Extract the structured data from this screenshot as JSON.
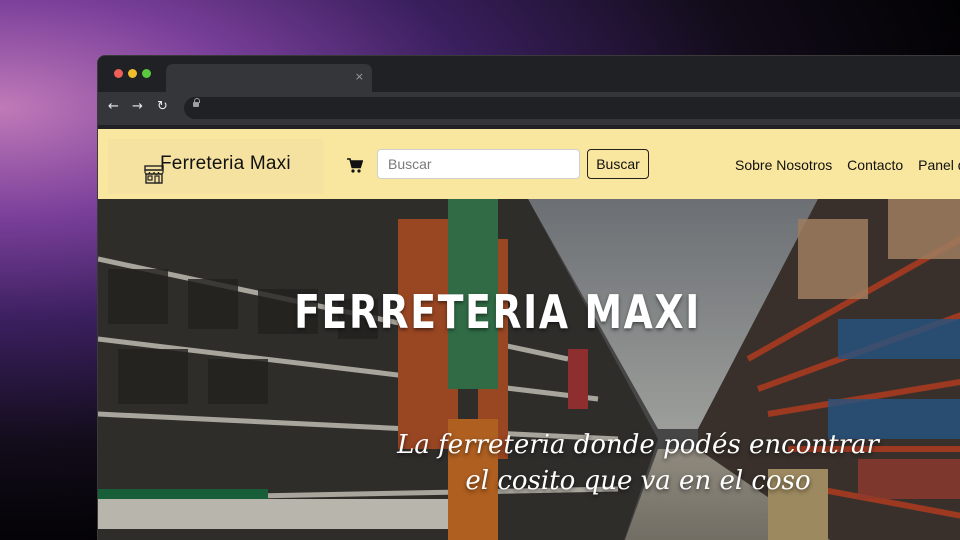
{
  "browser": {
    "tab_close": "×",
    "back": "←",
    "forward": "→",
    "reload": "↻"
  },
  "navbar": {
    "brand": "Ferreteria Maxi",
    "search_placeholder": "Buscar",
    "search_button": "Buscar",
    "links": [
      "Sobre Nosotros",
      "Contacto",
      "Panel de"
    ]
  },
  "hero": {
    "title": "FERRETERIA MAXI",
    "subtitle_line1": "La ferreteria donde podés encontrar",
    "subtitle_line2": "el cosito que va en el coso"
  },
  "colors": {
    "navbar_bg": "#f9e79f",
    "brand_box_bg": "#f6e2a0"
  }
}
